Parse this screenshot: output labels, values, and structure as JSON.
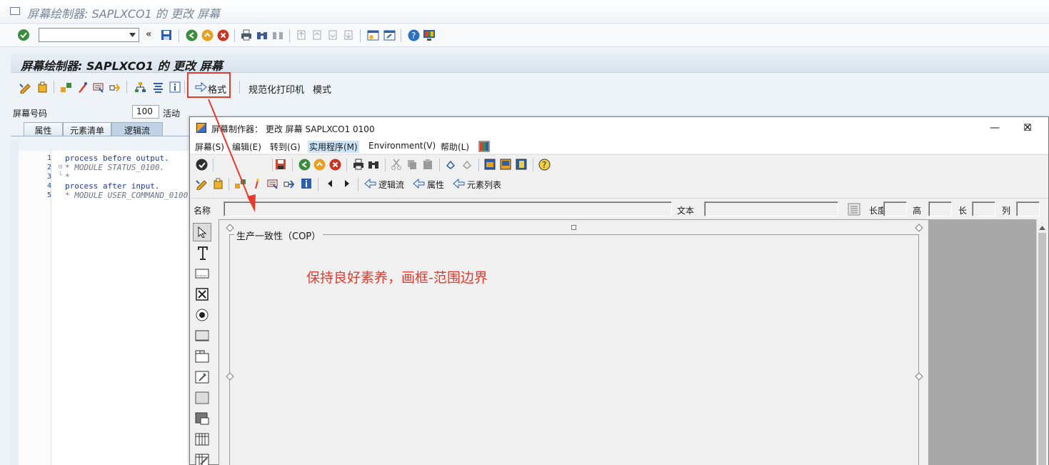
{
  "title_bar": {
    "title": "屏幕绘制器: SAPLXCO1 的 更改 屏幕"
  },
  "system_toolbar": {
    "command_field_value": "",
    "collapse_symbol": "«"
  },
  "app": {
    "header_title": "屏幕绘制器: SAPLXCO1 的 更改 屏幕",
    "toolbar": {
      "format_button": "格式",
      "normalized_printer": "规范化打印机",
      "mode": "模式"
    },
    "screen_number_label": "屏幕号码",
    "screen_number_value": "100",
    "screen_status": "活动",
    "tabs": [
      {
        "label": "属性",
        "active": false
      },
      {
        "label": "元素清单",
        "active": false
      },
      {
        "label": "逻辑流",
        "active": true
      }
    ],
    "flow_logic": [
      {
        "line": "1",
        "text": "process before output.",
        "fold": ""
      },
      {
        "line": "2",
        "text": "* MODULE STATUS_0100.",
        "fold": "⊟"
      },
      {
        "line": "3",
        "text": "*",
        "fold": "└"
      },
      {
        "line": "4",
        "text": "process after input.",
        "fold": ""
      },
      {
        "line": "5",
        "text": "* MODULE USER_COMMAND_0100.",
        "fold": ""
      }
    ]
  },
  "layout_window": {
    "title": "屏幕制作器： 更改 屏幕 SAPLXCO1 0100",
    "controls": {
      "minimize": "—",
      "maximize": "☐",
      "close": "✕"
    },
    "menus": [
      {
        "label": "屏幕(S)"
      },
      {
        "label": "编辑(E)"
      },
      {
        "label": "转到(G)"
      },
      {
        "label": "实用程序(M)",
        "highlighted": true
      },
      {
        "label": "Environment(V)"
      },
      {
        "label": "帮助(L)"
      }
    ],
    "toolbar2": {
      "flow_logic": "逻辑流",
      "attributes": "属性",
      "element_list": "元素列表"
    },
    "name_label": "名称",
    "name_value": "",
    "text_label": "文本",
    "text_value": "",
    "length_label": "长度",
    "height_label": "高",
    "length2_label": "长",
    "column_label": "列",
    "frame_title": "生产一致性（COP）",
    "annotation": "保持良好素养，画框-范围边界"
  },
  "colors": {
    "annotation": "#e53a2c",
    "accent": "#1e50a0",
    "highlight_box": "#e53a2c"
  }
}
